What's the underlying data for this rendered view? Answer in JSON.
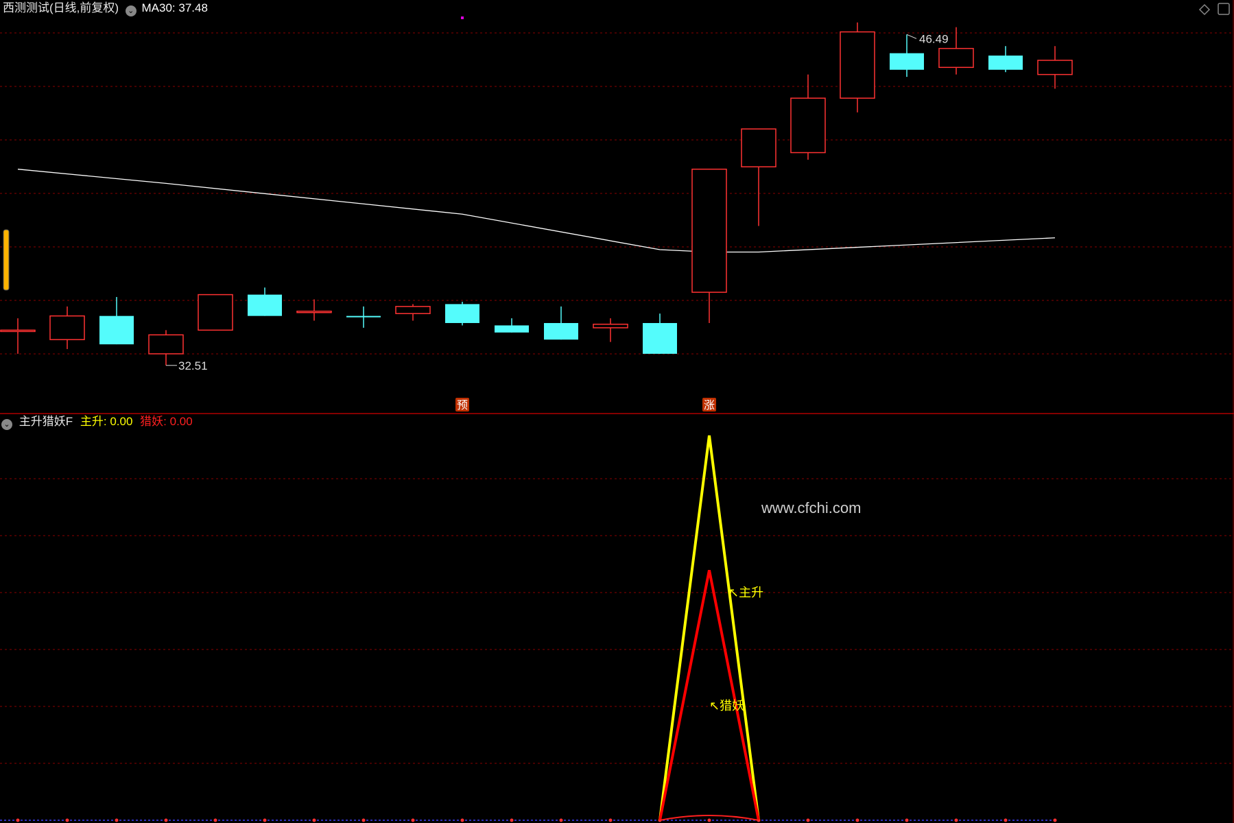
{
  "header": {
    "title": "西测测试(日线,前复权)",
    "ma_label": "MA30:",
    "ma_value": "37.48"
  },
  "indicator_header": {
    "title": "主升猎妖F",
    "zhusheng_label": "主升:",
    "zhusheng_value": "0.00",
    "lieyao_label": "猎妖:",
    "lieyao_value": "0.00"
  },
  "watermark": "www.cfchi.com",
  "colors": {
    "up": "#ff3232",
    "down": "#54fcfc",
    "ma": "#ffffff",
    "grid": "#8b0000",
    "zhusheng": "#ffff00",
    "lieyao": "#ff0000",
    "baseline_dots": "#4040ff"
  },
  "chart_data": [
    {
      "type": "candlestick",
      "price_range": [
        31.2,
        47.6
      ],
      "candles": [
        {
          "open": 34.0,
          "high": 34.5,
          "low": 33.0,
          "close": 34.0
        },
        {
          "open": 33.6,
          "high": 35.0,
          "low": 33.2,
          "close": 34.6
        },
        {
          "open": 34.6,
          "high": 35.4,
          "low": 33.4,
          "close": 33.4
        },
        {
          "open": 33.0,
          "high": 34.0,
          "low": 32.51,
          "close": 33.8
        },
        {
          "open": 34.0,
          "high": 35.5,
          "low": 34.0,
          "close": 35.5
        },
        {
          "open": 35.5,
          "high": 35.8,
          "low": 34.6,
          "close": 34.6
        },
        {
          "open": 34.8,
          "high": 35.3,
          "low": 34.4,
          "close": 34.8
        },
        {
          "open": 34.6,
          "high": 35.0,
          "low": 34.1,
          "close": 34.55
        },
        {
          "open": 34.7,
          "high": 35.1,
          "low": 34.4,
          "close": 35.0
        },
        {
          "open": 35.1,
          "high": 35.2,
          "low": 34.2,
          "close": 34.3
        },
        {
          "open": 34.2,
          "high": 34.5,
          "low": 33.9,
          "close": 33.9
        },
        {
          "open": 34.3,
          "high": 35.0,
          "low": 33.6,
          "close": 33.6
        },
        {
          "open": 34.1,
          "high": 34.5,
          "low": 33.5,
          "close": 34.25
        },
        {
          "open": 34.3,
          "high": 34.7,
          "low": 33.0,
          "close": 33.0
        },
        {
          "open": 35.6,
          "high": 38.2,
          "low": 34.3,
          "close": 40.8
        },
        {
          "open": 40.9,
          "high": 42.5,
          "low": 38.4,
          "close": 42.5
        },
        {
          "open": 41.5,
          "high": 44.8,
          "low": 41.2,
          "close": 43.8
        },
        {
          "open": 43.8,
          "high": 47.0,
          "low": 43.2,
          "close": 46.6
        },
        {
          "open": 45.7,
          "high": 46.49,
          "low": 44.7,
          "close": 45.0
        },
        {
          "open": 45.1,
          "high": 46.8,
          "low": 44.8,
          "close": 45.9
        },
        {
          "open": 45.6,
          "high": 46.0,
          "low": 44.9,
          "close": 45.0
        },
        {
          "open": 44.8,
          "high": 46.0,
          "low": 44.2,
          "close": 45.4
        }
      ],
      "ma30": [
        40.8,
        null,
        null,
        40.2,
        null,
        null,
        null,
        null,
        null,
        38.9,
        null,
        null,
        null,
        37.4,
        37.3,
        37.3,
        null,
        null,
        null,
        null,
        null,
        37.9
      ],
      "annotations": {
        "high_label": "46.49",
        "low_label": "32.51",
        "signals": [
          {
            "index": 9,
            "text": "预"
          },
          {
            "index": 14,
            "text": "涨"
          }
        ]
      }
    },
    {
      "type": "line",
      "y_range": [
        0,
        10
      ],
      "series": [
        {
          "name": "主升",
          "peak_index": 14,
          "values": {
            "13": 0,
            "14": 10,
            "15": 0
          }
        },
        {
          "name": "猎妖",
          "peak_index": 14,
          "values": {
            "13": 0,
            "14": 6.5,
            "15": 0
          }
        }
      ],
      "labels": {
        "zhusheng": "主升",
        "lieyao": "猎妖"
      }
    }
  ]
}
